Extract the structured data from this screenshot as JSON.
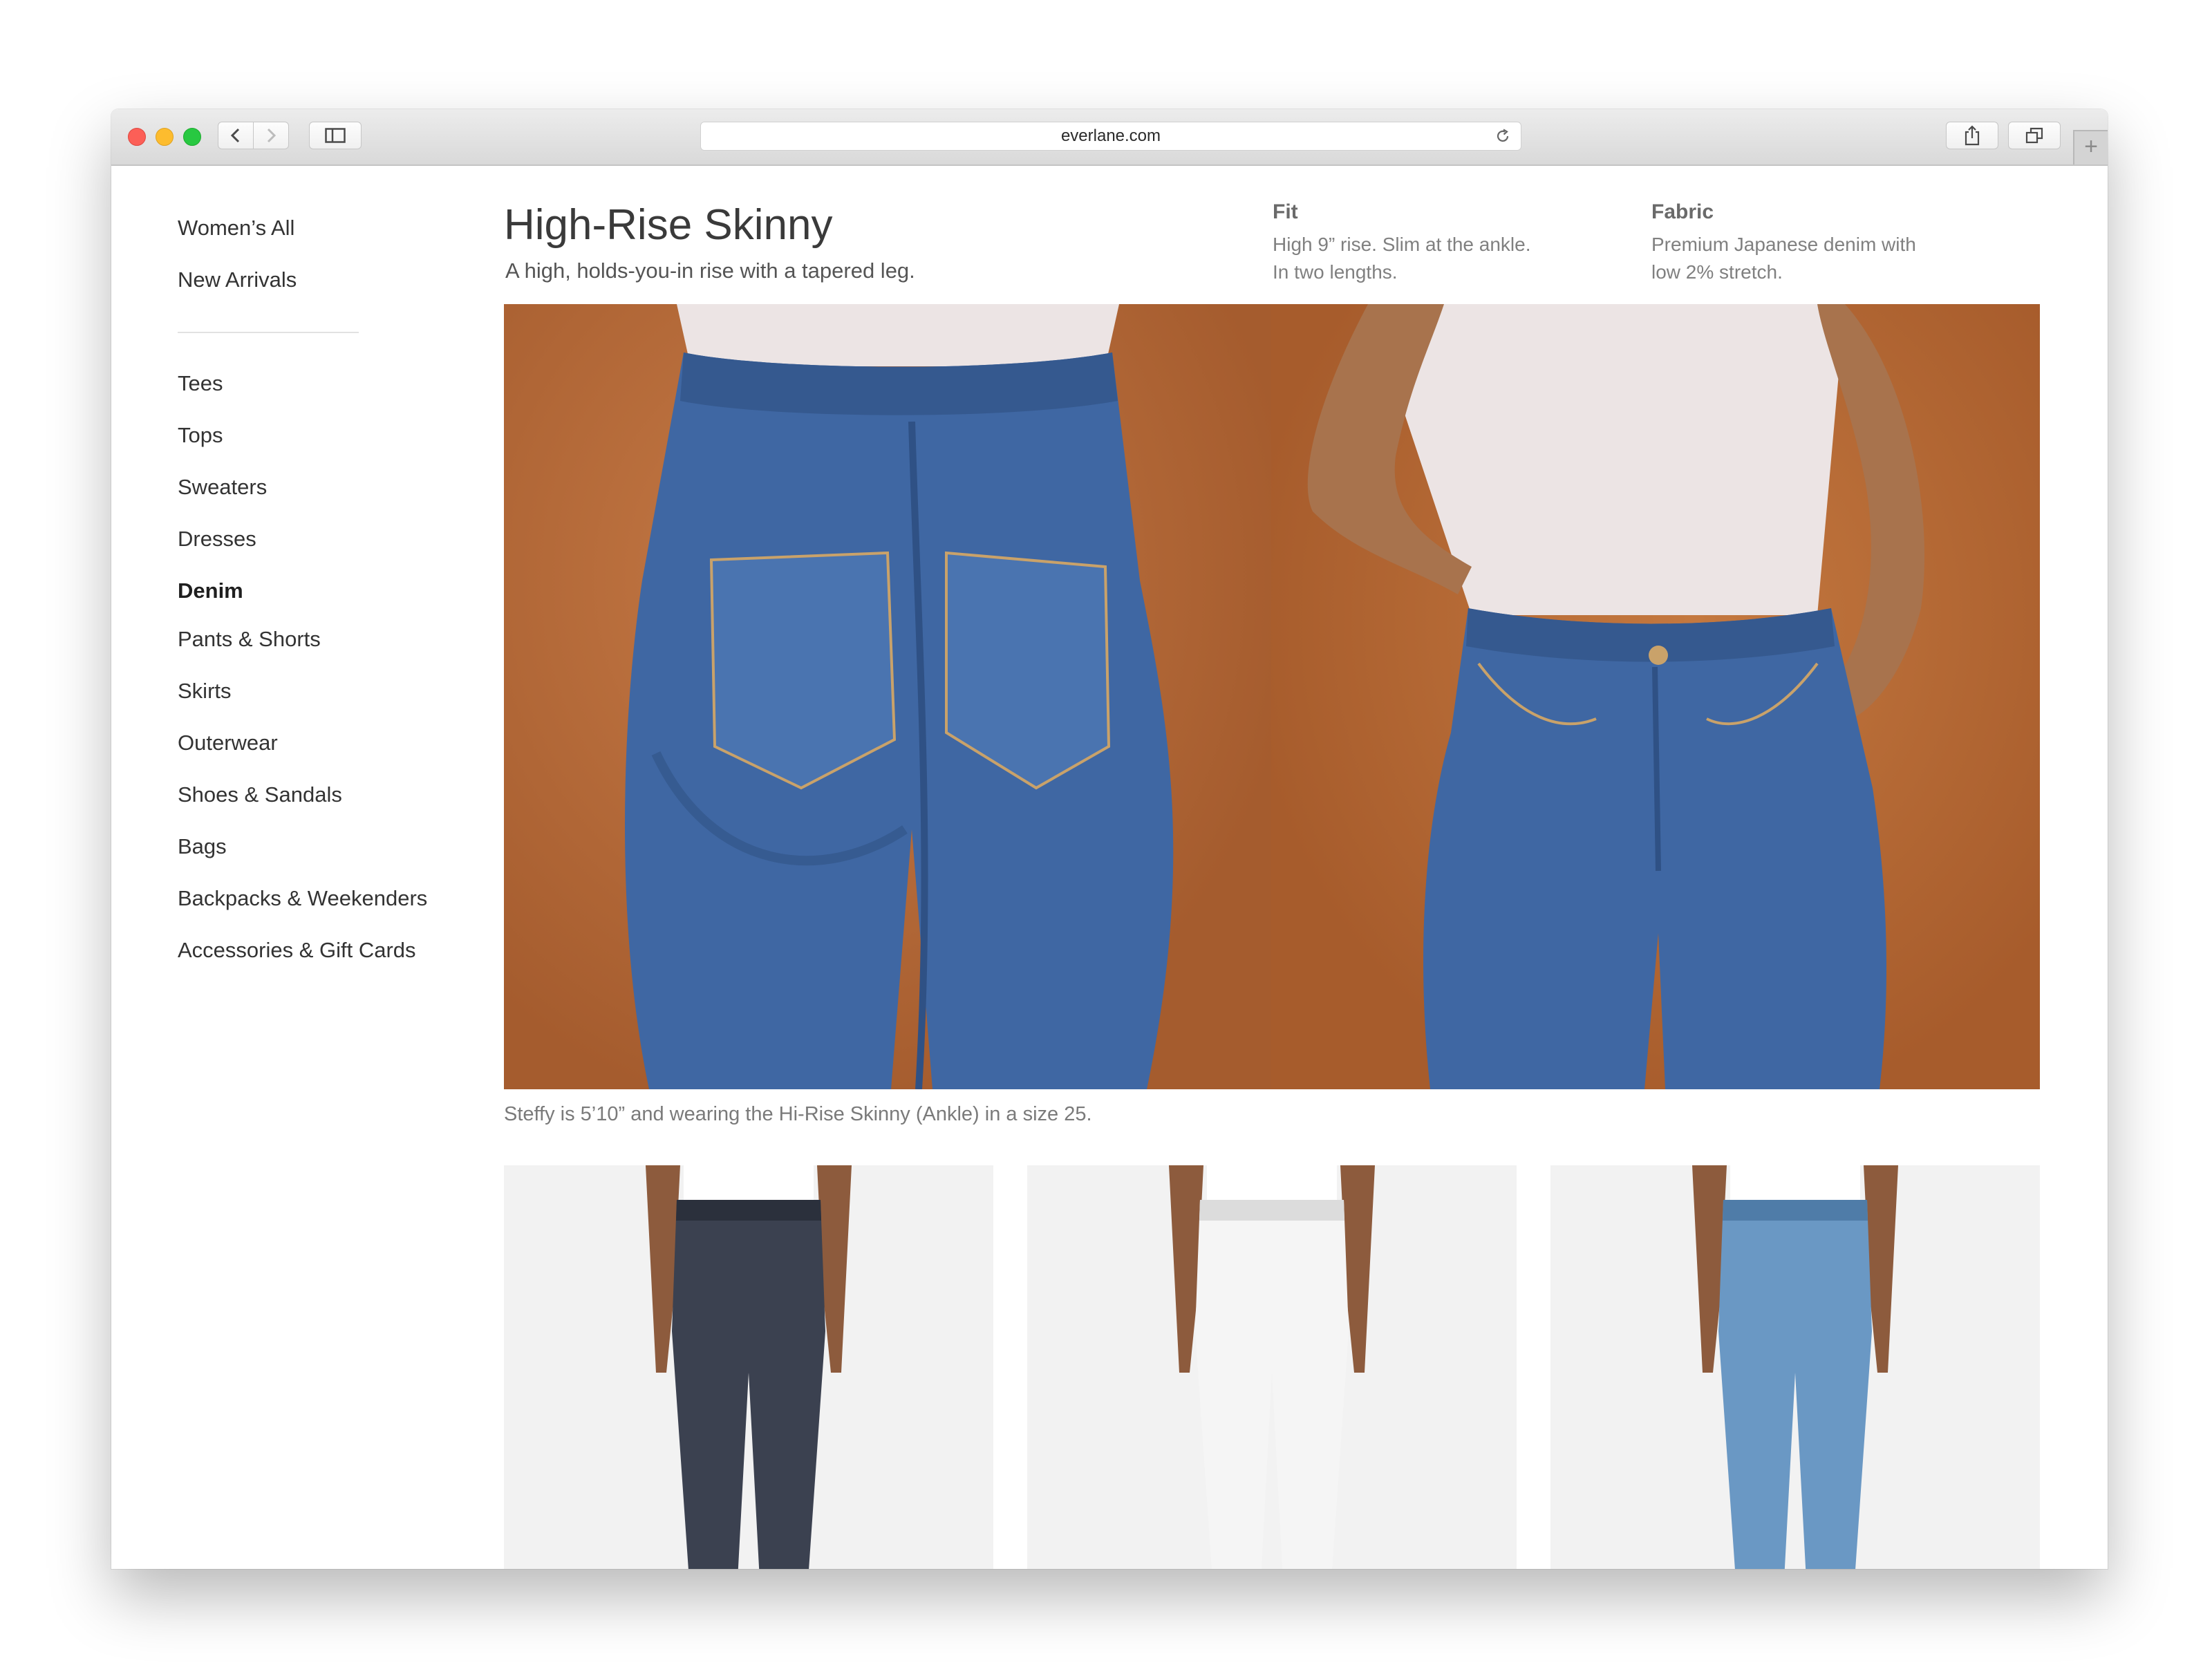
{
  "browser": {
    "url": "everlane.com",
    "buttons": {
      "back": "back-icon",
      "forward": "forward-icon",
      "sidebar": "sidebar-icon",
      "reload": "reload-icon",
      "share": "share-icon",
      "tabs": "tabs-icon",
      "new_tab": "+"
    }
  },
  "nav": {
    "top_items": [
      "Women’s All",
      "New Arrivals"
    ],
    "category_items": [
      "Tees",
      "Tops",
      "Sweaters",
      "Dresses",
      "Denim",
      "Pants & Shorts",
      "Skirts",
      "Outerwear",
      "Shoes & Sandals",
      "Bags",
      "Backpacks & Weekenders",
      "Accessories & Gift Cards"
    ],
    "active_item": "Denim"
  },
  "product": {
    "title": "High-Rise Skinny",
    "subtitle": "A high, holds-you-in rise with a tapered leg.",
    "fit": {
      "heading": "Fit",
      "line1": "High 9” rise. Slim at the ankle.",
      "line2": "In two lengths."
    },
    "fabric": {
      "heading": "Fabric",
      "line1": "Premium Japanese denim with",
      "line2": "low 2% stretch."
    },
    "caption": "Steffy is 5’10” and wearing the Hi-Rise Skinny (Ankle) in a size 25."
  },
  "colors": {
    "hero_background": "#b66a3a",
    "denim_mid": "#3f67a3",
    "tee": "#ece4e4",
    "skin": "#a8734d"
  },
  "product_cards": [
    {
      "variant": "dark rinse",
      "jean_color": "#3b4150",
      "jean_shade": "#2b303c"
    },
    {
      "variant": "white",
      "jean_color": "#f5f5f5",
      "jean_shade": "#dcdcdc"
    },
    {
      "variant": "light wash",
      "jean_color": "#6a98c4",
      "jean_shade": "#4f7ca8"
    }
  ]
}
